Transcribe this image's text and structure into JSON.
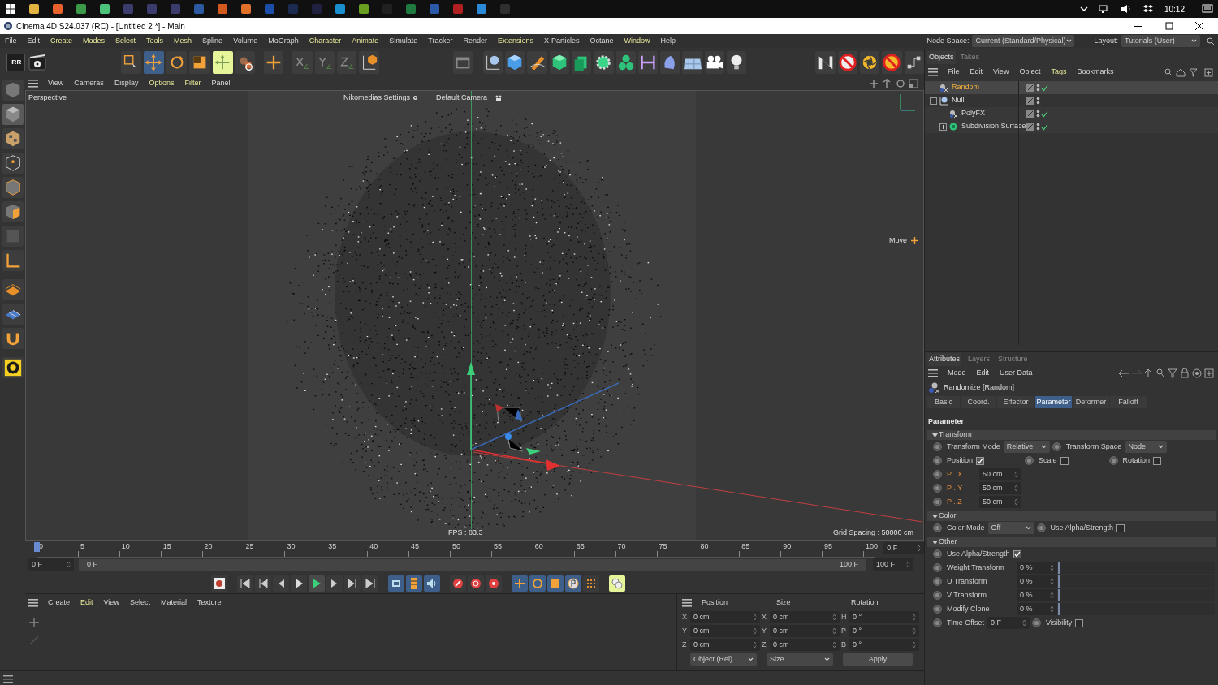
{
  "taskbar": {
    "time": "10:12"
  },
  "window": {
    "title": "Cinema 4D S24.037 (RC) - [Untitled 2 *] - Main"
  },
  "menu": [
    {
      "label": "File",
      "highlight": false
    },
    {
      "label": "Edit",
      "highlight": false
    },
    {
      "label": "Create",
      "highlight": true
    },
    {
      "label": "Modes",
      "highlight": true
    },
    {
      "label": "Select",
      "highlight": true
    },
    {
      "label": "Tools",
      "highlight": true
    },
    {
      "label": "Mesh",
      "highlight": true
    },
    {
      "label": "Spline",
      "highlight": false
    },
    {
      "label": "Volume",
      "highlight": false
    },
    {
      "label": "MoGraph",
      "highlight": false
    },
    {
      "label": "Character",
      "highlight": true
    },
    {
      "label": "Animate",
      "highlight": true
    },
    {
      "label": "Simulate",
      "highlight": false
    },
    {
      "label": "Tracker",
      "highlight": false
    },
    {
      "label": "Render",
      "highlight": false
    },
    {
      "label": "Extensions",
      "highlight": true
    },
    {
      "label": "X-Particles",
      "highlight": false
    },
    {
      "label": "Octane",
      "highlight": false
    },
    {
      "label": "Window",
      "highlight": true
    },
    {
      "label": "Help",
      "highlight": false
    }
  ],
  "node_space": {
    "label": "Node Space:",
    "value": "Current (Standard/Physical)"
  },
  "layout": {
    "label": "Layout:",
    "value": "Tutorials (User)"
  },
  "toolbar": {
    "irr_label": "IRR",
    "tools": [
      {
        "selected": false,
        "toggled": false
      },
      {
        "selected": true,
        "toggled": false
      },
      {
        "selected": false,
        "toggled": false
      },
      {
        "selected": false,
        "toggled": false
      },
      {
        "selected": false,
        "toggled": true
      }
    ]
  },
  "viewport": {
    "menu": [
      {
        "label": "View",
        "highlight": false
      },
      {
        "label": "Cameras",
        "highlight": false
      },
      {
        "label": "Display",
        "highlight": false
      },
      {
        "label": "Options",
        "highlight": true
      },
      {
        "label": "Filter",
        "highlight": true
      },
      {
        "label": "Panel",
        "highlight": false
      }
    ],
    "view_name": "Perspective",
    "settings_label": "Nikomedias Settings",
    "camera_label": "Default Camera",
    "tool_label": "Move",
    "fps": "FPS : 83.3",
    "grid_spacing": "Grid Spacing : 50000 cm"
  },
  "timeline": {
    "ruler_labels": [
      "0",
      "5",
      "10",
      "15",
      "20",
      "25",
      "30",
      "35",
      "40",
      "45",
      "50",
      "55",
      "60",
      "65",
      "70",
      "75",
      "80",
      "85",
      "90",
      "95",
      "100"
    ],
    "current_frame": "0 F",
    "range_start": "0 F",
    "range_end": "100 F",
    "min_field": "0 F",
    "max_field": "100 F"
  },
  "material_manager": {
    "menu": [
      {
        "label": "Create",
        "highlight": false
      },
      {
        "label": "Edit",
        "highlight": true
      },
      {
        "label": "View",
        "highlight": false
      },
      {
        "label": "Select",
        "highlight": false
      },
      {
        "label": "Material",
        "highlight": false
      },
      {
        "label": "Texture",
        "highlight": false
      }
    ]
  },
  "coordinates": {
    "headers": [
      "Position",
      "Size",
      "Rotation"
    ],
    "rows": [
      {
        "axes": [
          "X",
          "X",
          "H"
        ],
        "values": [
          "0 cm",
          "0 cm",
          "0 °"
        ]
      },
      {
        "axes": [
          "Y",
          "Y",
          "P"
        ],
        "values": [
          "0 cm",
          "0 cm",
          "0 °"
        ]
      },
      {
        "axes": [
          "Z",
          "Z",
          "B"
        ],
        "values": [
          "0 cm",
          "0 cm",
          "0 °"
        ]
      }
    ],
    "mode": "Object (Rel)",
    "size_mode": "Size",
    "apply": "Apply"
  },
  "objects": {
    "tabs": [
      {
        "label": "Objects",
        "selected": true
      },
      {
        "label": "Takes",
        "selected": false
      }
    ],
    "menu": [
      {
        "label": "File",
        "highlight": false
      },
      {
        "label": "Edit",
        "highlight": false
      },
      {
        "label": "View",
        "highlight": false
      },
      {
        "label": "Object",
        "highlight": false
      },
      {
        "label": "Tags",
        "highlight": true
      },
      {
        "label": "Bookmarks",
        "highlight": false
      }
    ],
    "tree": [
      {
        "name": "Random",
        "kind": "effector",
        "selected": true,
        "check": true
      },
      {
        "name": "Null",
        "kind": "null",
        "selected": false,
        "check": false,
        "expanded": true,
        "children": [
          {
            "name": "PolyFX",
            "kind": "effector",
            "selected": false,
            "check": true
          },
          {
            "name": "Subdivision Surface",
            "kind": "generator",
            "selected": false,
            "check": true,
            "expanded": false
          }
        ]
      }
    ]
  },
  "attributes": {
    "tabs": [
      {
        "label": "Attributes",
        "selected": true
      },
      {
        "label": "Layers",
        "selected": false
      },
      {
        "label": "Structure",
        "selected": false
      }
    ],
    "menu": [
      {
        "label": "Mode",
        "highlight": false
      },
      {
        "label": "Edit",
        "highlight": false
      },
      {
        "label": "User Data",
        "highlight": false
      }
    ],
    "object_title": "Randomize [Random]",
    "pages": [
      {
        "label": "Basic",
        "selected": false
      },
      {
        "label": "Coord.",
        "selected": false
      },
      {
        "label": "Effector",
        "selected": false
      },
      {
        "label": "Parameter",
        "selected": true
      },
      {
        "label": "Deformer",
        "selected": false
      },
      {
        "label": "Falloff",
        "selected": false
      }
    ],
    "section": "Parameter",
    "groups": [
      {
        "title": "Transform",
        "expanded": true,
        "rows": [
          {
            "items": [
              {
                "kind": "dropdown",
                "label": "Transform Mode",
                "value": "Relative"
              },
              {
                "kind": "dropdown",
                "label": "Transform Space",
                "value": "Node"
              }
            ]
          },
          {
            "items": [
              {
                "kind": "checkbox",
                "label": "Position",
                "checked": true
              },
              {
                "kind": "checkbox",
                "label": "Scale",
                "checked": false
              },
              {
                "kind": "checkbox",
                "label": "Rotation",
                "checked": false
              }
            ]
          },
          {
            "items": [
              {
                "kind": "number",
                "label": "P . X",
                "value": "50 cm",
                "highlight": true
              }
            ]
          },
          {
            "items": [
              {
                "kind": "number",
                "label": "P . Y",
                "value": "50 cm",
                "highlight": true
              }
            ]
          },
          {
            "items": [
              {
                "kind": "number",
                "label": "P . Z",
                "value": "50 cm",
                "highlight": true
              }
            ]
          }
        ]
      },
      {
        "title": "Color",
        "expanded": true,
        "rows": [
          {
            "items": [
              {
                "kind": "dropdown",
                "label": "Color Mode",
                "value": "Off"
              },
              {
                "kind": "checkbox",
                "label": "Use Alpha/Strength",
                "checked": false
              }
            ]
          }
        ]
      },
      {
        "title": "Other",
        "expanded": true,
        "rows": [
          {
            "items": [
              {
                "kind": "checkbox",
                "label": "Use Alpha/Strength",
                "checked": true
              }
            ]
          },
          {
            "items": [
              {
                "kind": "slider",
                "label": "Weight Transform",
                "value": "0 %",
                "level": 0
              }
            ]
          },
          {
            "items": [
              {
                "kind": "slider",
                "label": "U Transform",
                "value": "0 %",
                "level": 0
              }
            ]
          },
          {
            "items": [
              {
                "kind": "slider",
                "label": "V Transform",
                "value": "0 %",
                "level": 0
              }
            ]
          },
          {
            "items": [
              {
                "kind": "slider",
                "label": "Modify Clone",
                "value": "0 %",
                "level": 0
              }
            ]
          },
          {
            "items": [
              {
                "kind": "number",
                "label": "Time Offset",
                "value": "0 F",
                "highlight": false
              },
              {
                "kind": "checkbox",
                "label": "Visibility",
                "checked": false
              }
            ]
          }
        ]
      }
    ]
  }
}
